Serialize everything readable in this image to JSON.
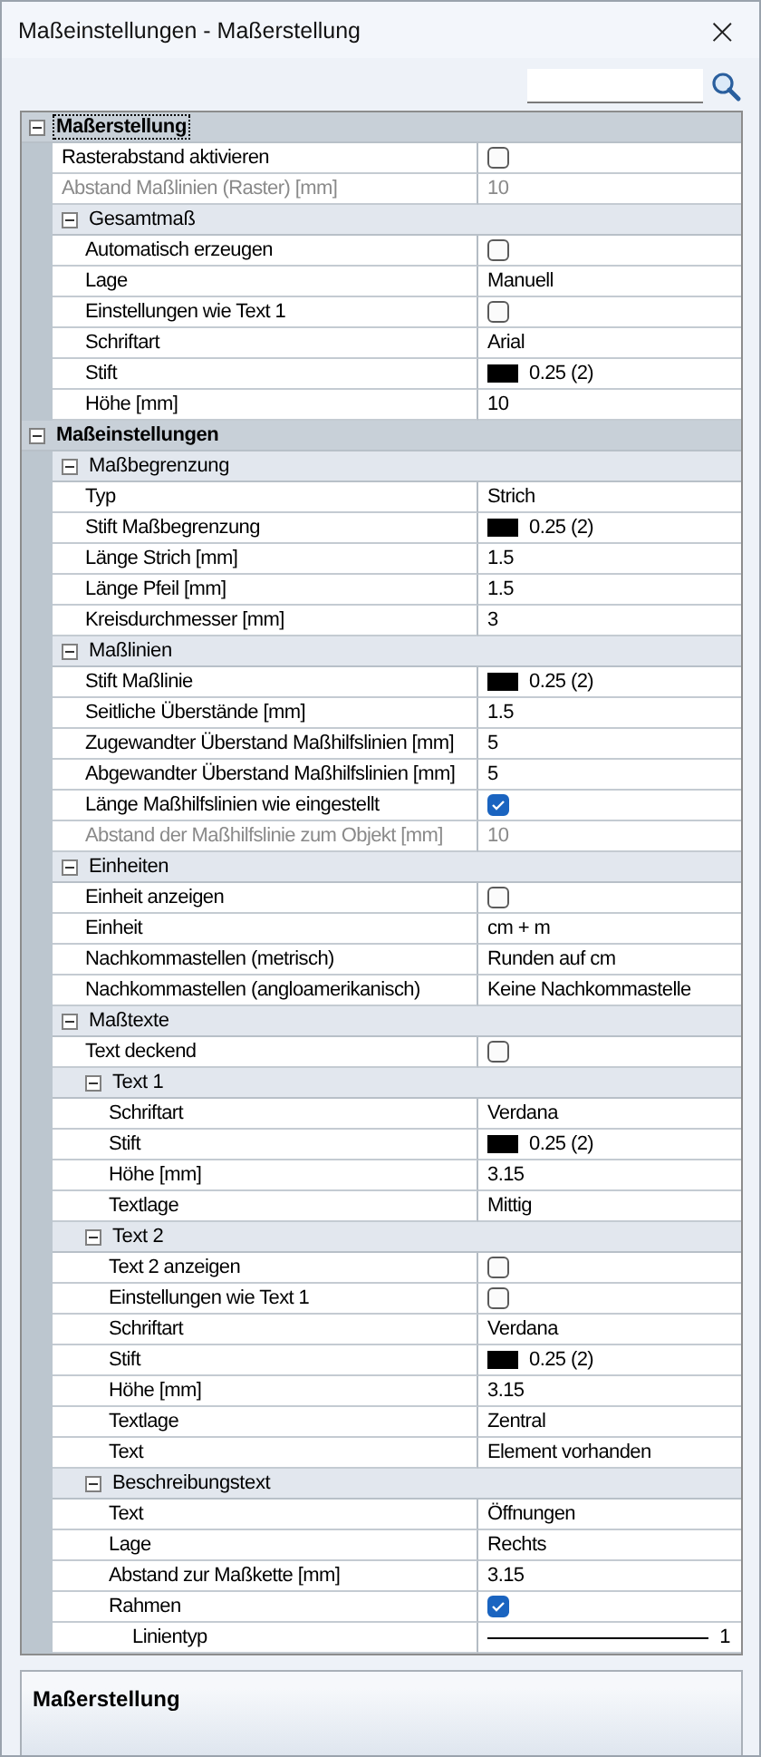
{
  "window": {
    "title": "Maßeinstellungen - Maßerstellung",
    "close": "×"
  },
  "grid": [
    {
      "kind": "category",
      "label": "Maßerstellung",
      "expanded": true,
      "selected": true,
      "children": [
        {
          "kind": "checkbox",
          "label": "Rasterabstand aktivieren",
          "checked": false,
          "disabled": false
        },
        {
          "kind": "text",
          "label": "Abstand Maßlinien (Raster) [mm]",
          "value": "10",
          "disabled": true
        },
        {
          "kind": "category",
          "label": "Gesamtmaß",
          "expanded": true,
          "selected": false,
          "children": [
            {
              "kind": "checkbox",
              "label": "Automatisch erzeugen",
              "checked": false,
              "disabled": false
            },
            {
              "kind": "text",
              "label": "Lage",
              "value": "Manuell",
              "disabled": false
            },
            {
              "kind": "checkbox",
              "label": "Einstellungen wie Text 1",
              "checked": false,
              "disabled": false
            },
            {
              "kind": "text",
              "label": "Schriftart",
              "value": "Arial",
              "disabled": false
            },
            {
              "kind": "pen",
              "label": "Stift",
              "value": "0.25 (2)",
              "disabled": false
            },
            {
              "kind": "text",
              "label": "Höhe [mm]",
              "value": "10",
              "disabled": false
            }
          ]
        }
      ]
    },
    {
      "kind": "category",
      "label": "Maßeinstellungen",
      "expanded": true,
      "selected": false,
      "children": [
        {
          "kind": "category",
          "label": "Maßbegrenzung",
          "expanded": true,
          "selected": false,
          "children": [
            {
              "kind": "text",
              "label": "Typ",
              "value": "Strich",
              "disabled": false
            },
            {
              "kind": "pen",
              "label": "Stift Maßbegrenzung",
              "value": "0.25 (2)",
              "disabled": false
            },
            {
              "kind": "text",
              "label": "Länge Strich [mm]",
              "value": "1.5",
              "disabled": false
            },
            {
              "kind": "text",
              "label": "Länge Pfeil [mm]",
              "value": "1.5",
              "disabled": false
            },
            {
              "kind": "text",
              "label": "Kreisdurchmesser [mm]",
              "value": "3",
              "disabled": false
            }
          ]
        },
        {
          "kind": "category",
          "label": "Maßlinien",
          "expanded": true,
          "selected": false,
          "children": [
            {
              "kind": "pen",
              "label": "Stift Maßlinie",
              "value": "0.25 (2)",
              "disabled": false
            },
            {
              "kind": "text",
              "label": "Seitliche Überstände [mm]",
              "value": "1.5",
              "disabled": false
            },
            {
              "kind": "text",
              "label": "Zugewandter Überstand Maßhilfslinien [mm]",
              "value": "5",
              "disabled": false
            },
            {
              "kind": "text",
              "label": "Abgewandter Überstand Maßhilfslinien [mm]",
              "value": "5",
              "disabled": false
            },
            {
              "kind": "checkbox",
              "label": "Länge Maßhilfslinien wie eingestellt",
              "checked": true,
              "disabled": false
            },
            {
              "kind": "text",
              "label": "Abstand der Maßhilfslinie zum Objekt [mm]",
              "value": "10",
              "disabled": true
            }
          ]
        },
        {
          "kind": "category",
          "label": "Einheiten",
          "expanded": true,
          "selected": false,
          "children": [
            {
              "kind": "checkbox",
              "label": "Einheit anzeigen",
              "checked": false,
              "disabled": false
            },
            {
              "kind": "text",
              "label": "Einheit",
              "value": "cm + m",
              "disabled": false
            },
            {
              "kind": "text",
              "label": "Nachkommastellen (metrisch)",
              "value": "Runden auf cm",
              "disabled": false
            },
            {
              "kind": "text",
              "label": "Nachkommastellen (angloamerikanisch)",
              "value": "Keine Nachkommastelle",
              "disabled": false
            }
          ]
        },
        {
          "kind": "category",
          "label": "Maßtexte",
          "expanded": true,
          "selected": false,
          "children": [
            {
              "kind": "checkbox",
              "label": "Text deckend",
              "checked": false,
              "disabled": false
            },
            {
              "kind": "category",
              "label": "Text 1",
              "expanded": true,
              "selected": false,
              "children": [
                {
                  "kind": "text",
                  "label": "Schriftart",
                  "value": "Verdana",
                  "disabled": false
                },
                {
                  "kind": "pen",
                  "label": "Stift",
                  "value": "0.25 (2)",
                  "disabled": false
                },
                {
                  "kind": "text",
                  "label": "Höhe [mm]",
                  "value": "3.15",
                  "disabled": false
                },
                {
                  "kind": "text",
                  "label": "Textlage",
                  "value": "Mittig",
                  "disabled": false
                }
              ]
            },
            {
              "kind": "category",
              "label": "Text 2",
              "expanded": true,
              "selected": false,
              "children": [
                {
                  "kind": "checkbox",
                  "label": "Text 2 anzeigen",
                  "checked": false,
                  "disabled": false
                },
                {
                  "kind": "checkbox",
                  "label": "Einstellungen wie Text 1",
                  "checked": false,
                  "disabled": false
                },
                {
                  "kind": "text",
                  "label": "Schriftart",
                  "value": "Verdana",
                  "disabled": false
                },
                {
                  "kind": "pen",
                  "label": "Stift",
                  "value": "0.25 (2)",
                  "disabled": false
                },
                {
                  "kind": "text",
                  "label": "Höhe [mm]",
                  "value": "3.15",
                  "disabled": false
                },
                {
                  "kind": "text",
                  "label": "Textlage",
                  "value": "Zentral",
                  "disabled": false
                },
                {
                  "kind": "text",
                  "label": "Text",
                  "value": "Element vorhanden",
                  "disabled": false
                }
              ]
            },
            {
              "kind": "category",
              "label": "Beschreibungstext",
              "expanded": true,
              "selected": false,
              "children": [
                {
                  "kind": "text",
                  "label": "Text",
                  "value": "Öffnungen",
                  "disabled": false
                },
                {
                  "kind": "text",
                  "label": "Lage",
                  "value": "Rechts",
                  "disabled": false
                },
                {
                  "kind": "text",
                  "label": "Abstand zur Maßkette [mm]",
                  "value": "3.15",
                  "disabled": false
                },
                {
                  "kind": "checkbox",
                  "label": "Rahmen",
                  "checked": true,
                  "disabled": false,
                  "children": [
                    {
                      "kind": "linetype",
                      "label": "Linientyp",
                      "value": "1",
                      "disabled": false
                    }
                  ]
                }
              ]
            }
          ]
        }
      ]
    }
  ],
  "description": {
    "title": "Maßerstellung"
  }
}
